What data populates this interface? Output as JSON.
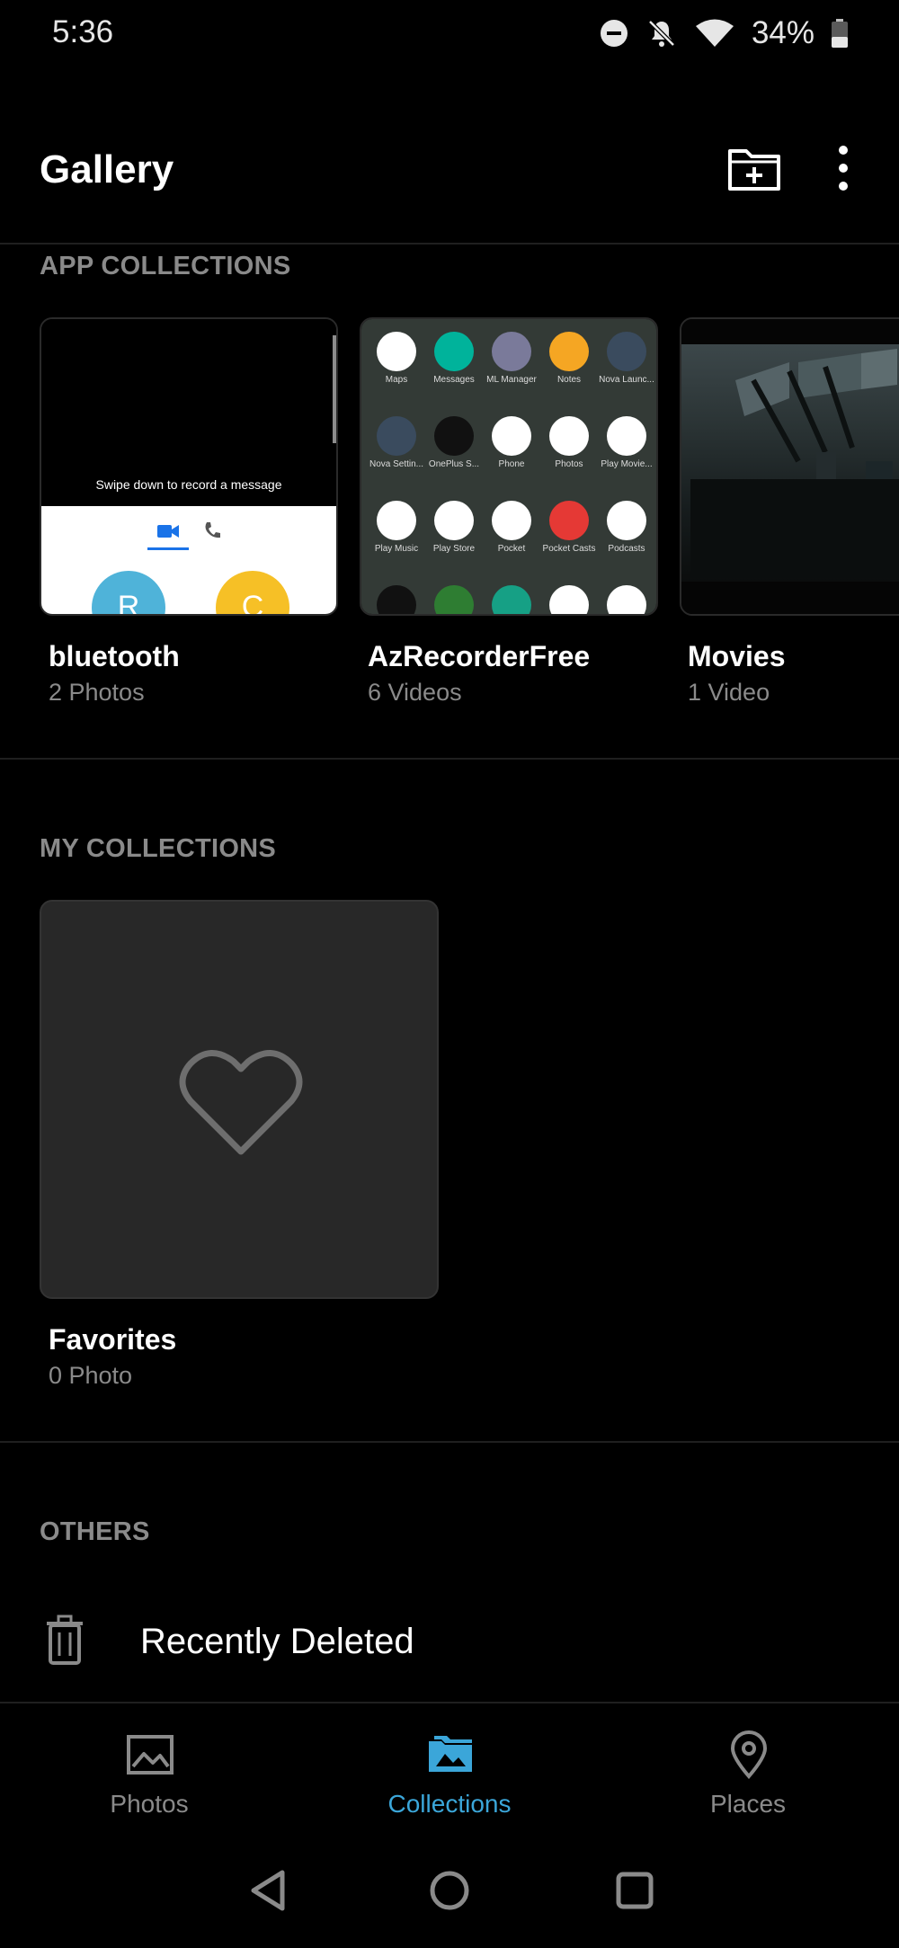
{
  "status_bar": {
    "time": "5:36",
    "battery": "34%"
  },
  "app_bar": {
    "title": "Gallery"
  },
  "sections": {
    "app_collections": "APP COLLECTIONS",
    "my_collections": "MY COLLECTIONS",
    "others": "OTHERS"
  },
  "app_collections": [
    {
      "name": "bluetooth",
      "count": "2 Photos"
    },
    {
      "name": "AzRecorderFree",
      "count": "6 Videos"
    },
    {
      "name": "Movies",
      "count": "1 Video"
    }
  ],
  "bluetooth_thumb": {
    "caption": "Swipe down to record a message",
    "avatar_1": "R",
    "avatar_2": "C"
  },
  "az_thumb_apps": [
    "Maps",
    "Messages",
    "ML Manager",
    "Notes",
    "Nova Launc...",
    "Nova Settin...",
    "OnePlus S...",
    "Phone",
    "Photos",
    "Play Movie...",
    "Play Music",
    "Play Store",
    "Pocket",
    "Pocket Casts",
    "Podcasts"
  ],
  "az_thumb_colors": [
    "#ffffff",
    "#00b39b",
    "#7a7a9a",
    "#f5a623",
    "#3a4b5e",
    "#3a4b5e",
    "#111111",
    "#ffffff",
    "#ffffff",
    "#ffffff",
    "#ffffff",
    "#ffffff",
    "#ffffff",
    "#e53935",
    "#ffffff"
  ],
  "my_collections": [
    {
      "name": "Favorites",
      "count": "0 Photo"
    }
  ],
  "others": [
    {
      "label": "Recently Deleted"
    }
  ],
  "bottom_nav": [
    {
      "label": "Photos",
      "active": false
    },
    {
      "label": "Collections",
      "active": true
    },
    {
      "label": "Places",
      "active": false
    }
  ],
  "colors": {
    "accent": "#3ba6d9",
    "background": "#000000",
    "secondary_text": "#8a8a8a"
  }
}
